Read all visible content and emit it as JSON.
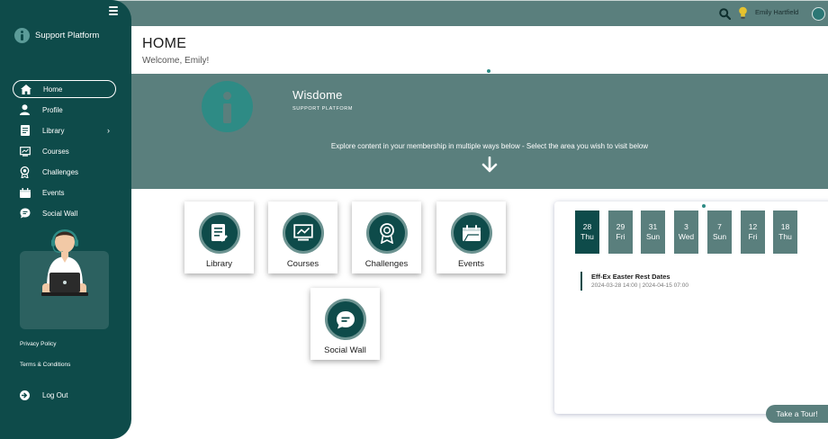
{
  "brand": {
    "name": "Support Platform"
  },
  "nav": [
    {
      "label": "Home",
      "icon": "home-icon"
    },
    {
      "label": "Profile",
      "icon": "user-icon"
    },
    {
      "label": "Library",
      "icon": "document-icon",
      "chevron": "›"
    },
    {
      "label": "Courses",
      "icon": "courses-icon"
    },
    {
      "label": "Challenges",
      "icon": "award-icon"
    },
    {
      "label": "Events",
      "icon": "calendar-icon"
    },
    {
      "label": "Social Wall",
      "icon": "chat-icon"
    }
  ],
  "sidebar_footer": {
    "privacy": "Privacy Policy",
    "terms": "Terms & Conditions",
    "logout": "Log Out"
  },
  "topbar": {
    "user_name": "Emily Hartfield"
  },
  "header": {
    "title": "HOME",
    "welcome": "Welcome, Emily!"
  },
  "hero": {
    "title": "Wisdome",
    "subtitle": "SUPPORT PLATFORM",
    "text": "Explore content in your membership in multiple ways below - Select the area you wish to visit below"
  },
  "tiles": [
    {
      "label": "Library",
      "icon": "document-icon"
    },
    {
      "label": "Courses",
      "icon": "courses-icon"
    },
    {
      "label": "Challenges",
      "icon": "award-icon"
    },
    {
      "label": "Events",
      "icon": "calendar-icon"
    },
    {
      "label": "Social Wall",
      "icon": "chat-icon"
    }
  ],
  "calendar": {
    "days": [
      {
        "d": "28",
        "w": "Thu"
      },
      {
        "d": "29",
        "w": "Fri"
      },
      {
        "d": "31",
        "w": "Sun"
      },
      {
        "d": "3",
        "w": "Wed"
      },
      {
        "d": "7",
        "w": "Sun"
      },
      {
        "d": "12",
        "w": "Fri"
      },
      {
        "d": "18",
        "w": "Thu"
      }
    ],
    "event": {
      "title": "Eff-Ex Easter Rest Dates",
      "time": "2024-03-28 14:00 | 2024-04-15 07:00"
    }
  },
  "tour_label": "Take a Tour!",
  "colors": {
    "primary": "#0e4b4a",
    "secondary": "#5a7f7d",
    "accent": "#2e8b85"
  }
}
